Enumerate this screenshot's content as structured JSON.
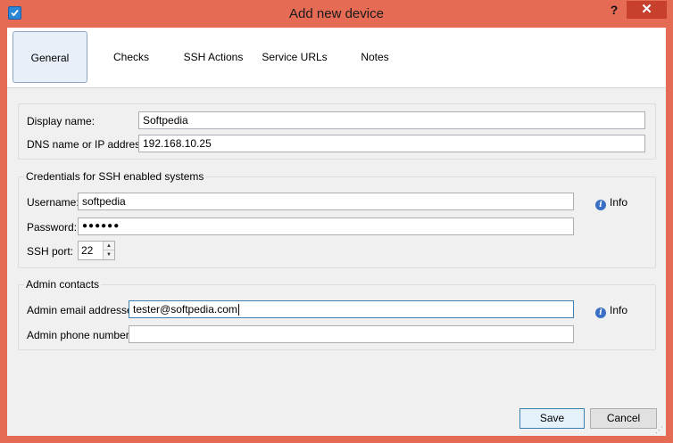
{
  "window": {
    "title": "Add new device",
    "help_label": "?",
    "close_label": "✕"
  },
  "tabs": [
    {
      "label": "General",
      "active": true
    },
    {
      "label": "Checks",
      "active": false
    },
    {
      "label": "SSH Actions",
      "active": false
    },
    {
      "label": "Service URLs",
      "active": false
    },
    {
      "label": "Notes",
      "active": false
    }
  ],
  "device": {
    "display_name_label": "Display name:",
    "display_name_value": "Softpedia",
    "dns_label": "DNS name or IP address:",
    "dns_value": "192.168.10.25"
  },
  "credentials": {
    "group_title": "Credentials for SSH enabled systems",
    "username_label": "Username:",
    "username_value": "softpedia",
    "password_label": "Password:",
    "password_value": "●●●●●●",
    "ssh_port_label": "SSH port:",
    "ssh_port_value": "22",
    "info_label": "Info"
  },
  "admin": {
    "group_title": "Admin contacts",
    "email_label": "Admin email addresses",
    "email_value": "tester@softpedia.com",
    "phone_label": "Admin phone numbers",
    "phone_value": "",
    "info_label": "Info"
  },
  "footer": {
    "save_label": "Save",
    "cancel_label": "Cancel"
  },
  "colors": {
    "frame": "#e66b55",
    "close_button": "#c7402e",
    "active_tab_border": "#8aa6c8",
    "focus_border": "#3c7fb1",
    "info_icon": "#3a6fc4"
  }
}
